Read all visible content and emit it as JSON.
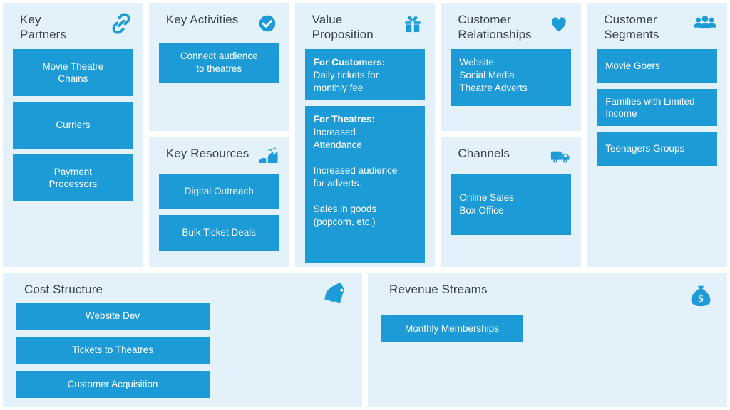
{
  "theme": {
    "panel_bg": "#e2f1fa",
    "box_bg": "#1d9bd7",
    "box_text": "#ffffff",
    "title_text": "#37474f",
    "page_bg": "#ffffff"
  },
  "blocks": {
    "key_partners": {
      "title": "Key\nPartners",
      "icon": "link-chain-icon",
      "items": [
        "Movie Theatre\nChains",
        "Curriers",
        "Payment\nProcessors"
      ]
    },
    "key_activities": {
      "title": "Key Activities",
      "icon": "check-circle-icon",
      "items": [
        "Connect audience\nto theatres"
      ]
    },
    "key_resources": {
      "title": "Key Resources",
      "icon": "factory-icon",
      "items": [
        "Digital Outreach",
        "Bulk Ticket Deals"
      ]
    },
    "value_proposition": {
      "title": "Value\nProposition",
      "icon": "gift-icon",
      "items": [
        {
          "heading": "For Customers:",
          "body": "Daily tickets for\nmonthly fee"
        },
        {
          "heading": "For Theatres:",
          "body": "Increased\nAttendance\n\nIncreased audience\nfor adverts.\n\nSales in goods\n(popcorn, etc.)"
        }
      ]
    },
    "customer_relationships": {
      "title": "Customer\nRelationships",
      "icon": "heart-icon",
      "items": [
        "Website\nSocial Media\nTheatre Adverts"
      ]
    },
    "channels": {
      "title": "Channels",
      "icon": "delivery-truck-icon",
      "items": [
        "Online Sales\nBox Office"
      ]
    },
    "customer_segments": {
      "title": "Customer\nSegments",
      "icon": "people-group-icon",
      "items": [
        "Movie Goers",
        "Families with Limited\nIncome",
        "Teenagers Groups"
      ]
    },
    "cost_structure": {
      "title": "Cost Structure",
      "icon": "price-tags-icon",
      "items": [
        "Website Dev",
        "Tickets to Theatres",
        "Customer Acquisition"
      ]
    },
    "revenue_streams": {
      "title": "Revenue Streams",
      "icon": "money-bag-icon",
      "items": [
        "Monthly Memberships"
      ]
    }
  }
}
